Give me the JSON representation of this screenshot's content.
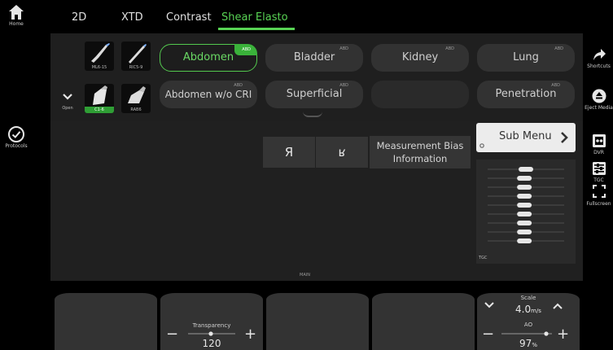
{
  "left_rail": {
    "home_label": "Home",
    "protocols_label": "Protocols"
  },
  "tabs": [
    {
      "label": "2D",
      "active": false
    },
    {
      "label": "XTD",
      "active": false
    },
    {
      "label": "Contrast",
      "active": false
    },
    {
      "label": "Shear Elasto",
      "active": true
    }
  ],
  "probes": [
    {
      "label": "ML6-15",
      "selected": false
    },
    {
      "label": "RIC5-9",
      "selected": false
    },
    {
      "label": "C1-6",
      "selected": true
    },
    {
      "label": "RAB6",
      "selected": false
    }
  ],
  "open_label": "Open",
  "presets": [
    {
      "label": "Abdomen",
      "tag": "ABD",
      "active": true
    },
    {
      "label": "Bladder",
      "tag": "ABD",
      "active": false
    },
    {
      "label": "Kidney",
      "tag": "ABD",
      "active": false
    },
    {
      "label": "Lung",
      "tag": "ABD",
      "active": false
    },
    {
      "label": "Abdomen w/o CRI",
      "tag": "ABD",
      "active": false
    },
    {
      "label": "Superficial",
      "tag": "ABD",
      "active": false
    },
    {
      "label": "",
      "tag": "",
      "active": false
    },
    {
      "label": "Penetration",
      "tag": "ABD",
      "active": false
    }
  ],
  "main": {
    "flip_lr_label": "Я",
    "flip_ud_label": "ʁ",
    "measurement_bias_line1": "Measurement Bias",
    "measurement_bias_line2": "Information",
    "main_label": "MAIN",
    "submenu_label": "Sub Menu",
    "tgc_label": "TGC",
    "tgc_levels": [
      0.5,
      0.48,
      0.48,
      0.48,
      0.48,
      0.48,
      0.48,
      0.48,
      0.48
    ]
  },
  "right_rail": {
    "shortcut_label": "Shortcuts",
    "eject_label": "Eject Media",
    "dvr_label": "DVR",
    "tgc_label": "TGC",
    "fullscreen_label": "Fullscreen"
  },
  "bottom": {
    "transparency_title": "Transparency",
    "transparency_value": "120",
    "scale_title": "Scale",
    "scale_value": "4.0",
    "scale_unit": "m/s",
    "ao_title": "AO",
    "ao_value": "97",
    "ao_unit": "%"
  },
  "colors": {
    "accent_green": "#58d354",
    "background": "#000000",
    "panel": "#1f1f1f"
  }
}
